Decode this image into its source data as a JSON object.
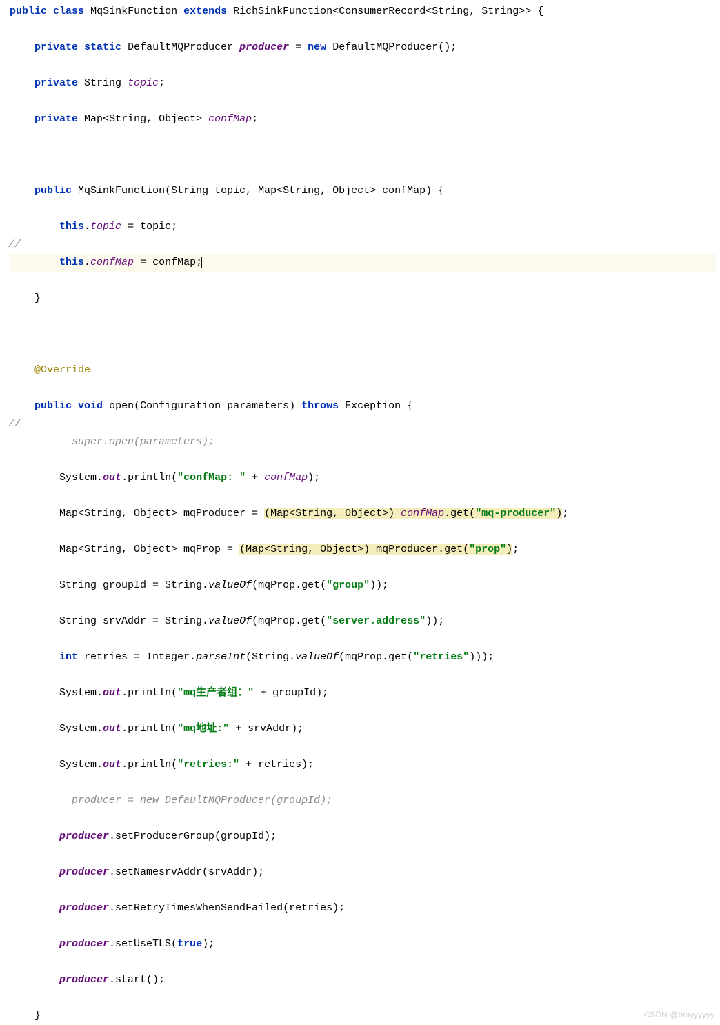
{
  "kw_public": "public",
  "kw_class": "class",
  "kw_extends": "extends",
  "kw_private": "private",
  "kw_static": "static",
  "kw_new": "new",
  "kw_this": "this",
  "kw_void": "void",
  "kw_throws": "throws",
  "kw_int": "int",
  "kw_true": "true",
  "cls_name": "MqSinkFunction",
  "rich": "RichSinkFunction",
  "consrec": "ConsumerRecord",
  "string": "String",
  "defprod": "DefaultMQProducer",
  "producer": "producer",
  "topic": "topic",
  "map": "Map",
  "object": "Object",
  "confMap": "confMap",
  "ctor_sig": "(String topic, Map<String, Object> confMap) {",
  "assign_topic": " = topic;",
  "assign_conf": " = confMap;",
  "override": "@Override",
  "open_sig": "open(Configuration parameters) ",
  "exception": "Exception {",
  "cmt_superopen": "super.open(parameters);",
  "system": "System",
  "out": "out",
  "println": ".println(",
  "str_confmap": "\"confMap: \"",
  "plus_confmap": " + ",
  "mqprod_decl": "Map<String, Object> mqProducer = ",
  "cast1": "(Map<String, Object>) ",
  "get": "get",
  "str_mqproducer": "\"mq-producer\"",
  "mqprop_decl": "Map<String, Object> mqProp = ",
  "cast2": "(Map<String, Object>) ",
  "mqProducer": "mqProducer",
  "str_prop": "\"prop\"",
  "groupid_decl": "String groupId = String.",
  "valueOf": "valueOf",
  "mqProp": "mqProp",
  "str_group": "\"group\"",
  "srvaddr_decl": "String srvAddr = String.",
  "str_serveraddr": "\"server.address\"",
  "retries_decl": " retries = Integer.",
  "parseInt": "parseInt",
  "str_retries": "\"retries\"",
  "str_mqgroup": "\"mq生产者组：\"",
  "plus_groupid": " + groupId);",
  "str_mqaddr": "\"mq地址:\"",
  "plus_srvaddr": " + srvAddr);",
  "str_retries_lbl": "\"retries:\"",
  "plus_retries": " + retries);",
  "cmt_producer": "producer = new DefaultMQProducer(groupId);",
  "setProducerGroup": ".setProducerGroup(groupId);",
  "setNamesrvAddr": ".setNamesrvAddr(srvAddr);",
  "setRetry": ".setRetryTimesWhenSendFailed(retries);",
  "setUseTLS": ".setUseTLS(",
  "start": ".start();",
  "watermark": "CSDN @bmyyyyyy",
  "gutter_slash": "//"
}
